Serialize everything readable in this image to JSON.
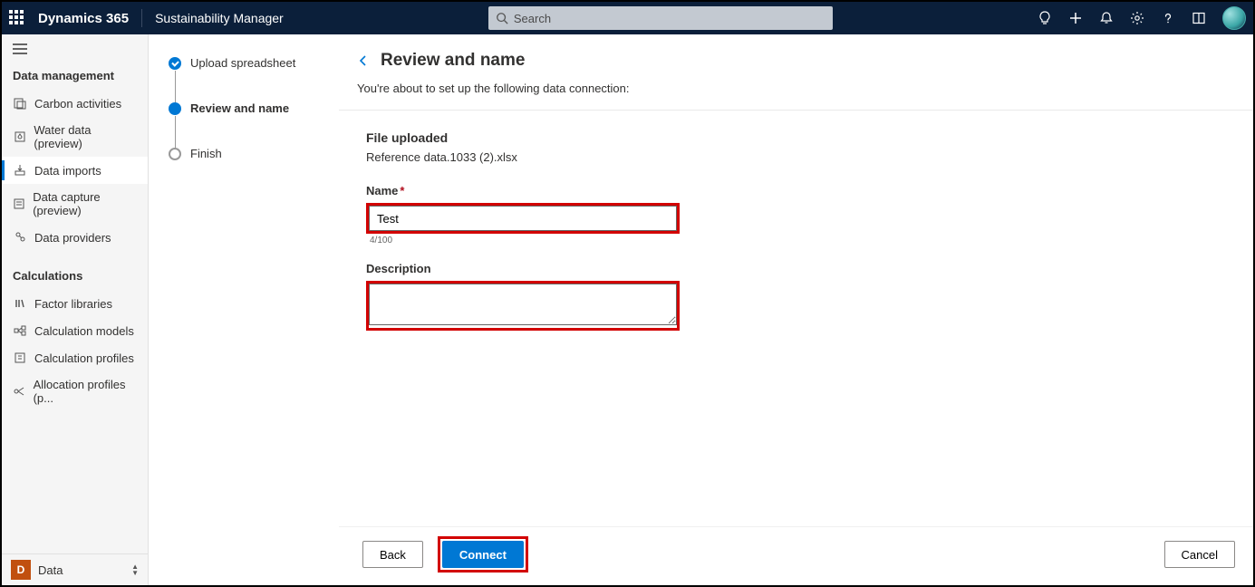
{
  "header": {
    "brand": "Dynamics 365",
    "product": "Sustainability Manager",
    "search_placeholder": "Search"
  },
  "sidebar": {
    "sections": [
      {
        "title": "Data management",
        "items": [
          {
            "label": "Carbon activities",
            "icon": "carbon-icon"
          },
          {
            "label": "Water data (preview)",
            "icon": "water-icon"
          },
          {
            "label": "Data imports",
            "icon": "import-icon",
            "active": true
          },
          {
            "label": "Data capture (preview)",
            "icon": "capture-icon"
          },
          {
            "label": "Data providers",
            "icon": "providers-icon"
          }
        ]
      },
      {
        "title": "Calculations",
        "items": [
          {
            "label": "Factor libraries",
            "icon": "library-icon"
          },
          {
            "label": "Calculation models",
            "icon": "models-icon"
          },
          {
            "label": "Calculation profiles",
            "icon": "profiles-icon"
          },
          {
            "label": "Allocation profiles (p...",
            "icon": "allocation-icon"
          }
        ]
      }
    ],
    "env": {
      "badge": "D",
      "name": "Data"
    }
  },
  "steps": [
    {
      "label": "Upload spreadsheet",
      "state": "done"
    },
    {
      "label": "Review and name",
      "state": "current"
    },
    {
      "label": "Finish",
      "state": "pending"
    }
  ],
  "page": {
    "title": "Review and name",
    "subtitle": "You're about to set up the following data connection:",
    "file_section": "File uploaded",
    "file_name": "Reference data.1033 (2).xlsx",
    "name_label": "Name",
    "name_value": "Test",
    "name_count": "4/100",
    "desc_label": "Description",
    "desc_value": ""
  },
  "buttons": {
    "back": "Back",
    "connect": "Connect",
    "cancel": "Cancel"
  }
}
